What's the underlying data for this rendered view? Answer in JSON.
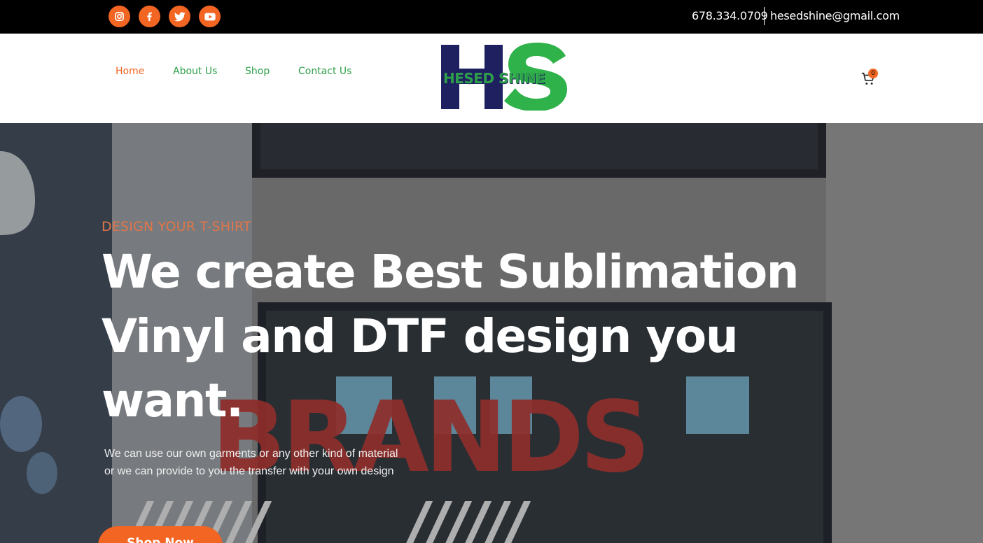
{
  "topbar": {
    "social": [
      {
        "icon": "instagram-icon"
      },
      {
        "icon": "facebook-icon"
      },
      {
        "icon": "twitter-icon"
      },
      {
        "icon": "youtube-icon"
      }
    ],
    "phone": "678.334.0709",
    "email": "hesedshine@gmail.com"
  },
  "nav": {
    "items": [
      {
        "label": "Home",
        "active": true
      },
      {
        "label": "About Us",
        "active": false
      },
      {
        "label": "Shop",
        "active": false
      },
      {
        "label": "Contact Us",
        "active": false
      }
    ]
  },
  "logo": {
    "text": "HESED SHINE",
    "colors": {
      "h": "#1e2060",
      "s": "#2fb24a"
    }
  },
  "cart": {
    "icon": "cart-icon",
    "count": "0"
  },
  "hero": {
    "eyebrow": "DESIGN YOUR T-SHIRT",
    "headline_line1": "We create Best Sublimation",
    "headline_line2": "Vinyl and DTF design you want.",
    "background_word": "BRANDS",
    "subtext_line1": "We can use our own garments or any other kind of material",
    "subtext_line2": "or we can provide to you the transfer with your own design",
    "cta_label": "Shop Now"
  },
  "colors": {
    "accent": "#f26522",
    "nav_green": "#2e9e4a",
    "topbar_bg": "#000000"
  }
}
